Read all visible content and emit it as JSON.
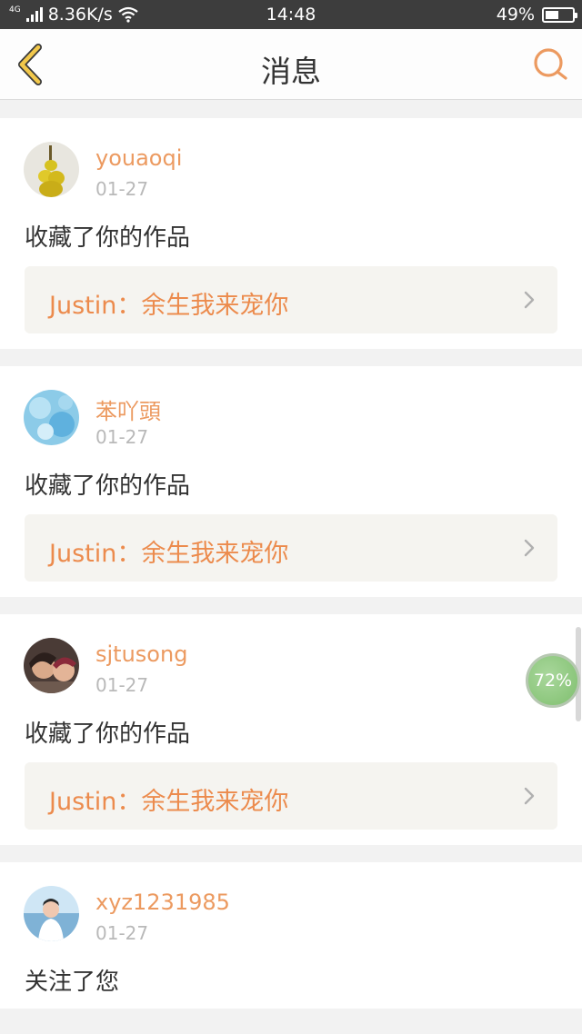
{
  "status_bar": {
    "network_tag": "4G",
    "speed": "8.36K/s",
    "time": "14:48",
    "battery": "49%",
    "battery_level": 0.49
  },
  "header": {
    "title": "消息",
    "back_icon": "chevron-left-icon",
    "search_icon": "search-icon",
    "accent_color": "#ec9a60",
    "back_color": "#f2c84b"
  },
  "messages": [
    {
      "username": "youaoqi",
      "date": "01-27",
      "action": "收藏了你的作品",
      "work": "Justin：余生我来宠你"
    },
    {
      "username": "苯吖頭",
      "date": "01-27",
      "action": "收藏了你的作品",
      "work": "Justin：余生我来宠你"
    },
    {
      "username": "sjtusong",
      "date": "01-27",
      "action": "收藏了你的作品",
      "work": "Justin：余生我来宠你"
    },
    {
      "username": "xyz1231985",
      "date": "01-27",
      "action": "关注了您"
    }
  ],
  "overlay": {
    "progress_label": "72%",
    "progress": 0.72
  }
}
